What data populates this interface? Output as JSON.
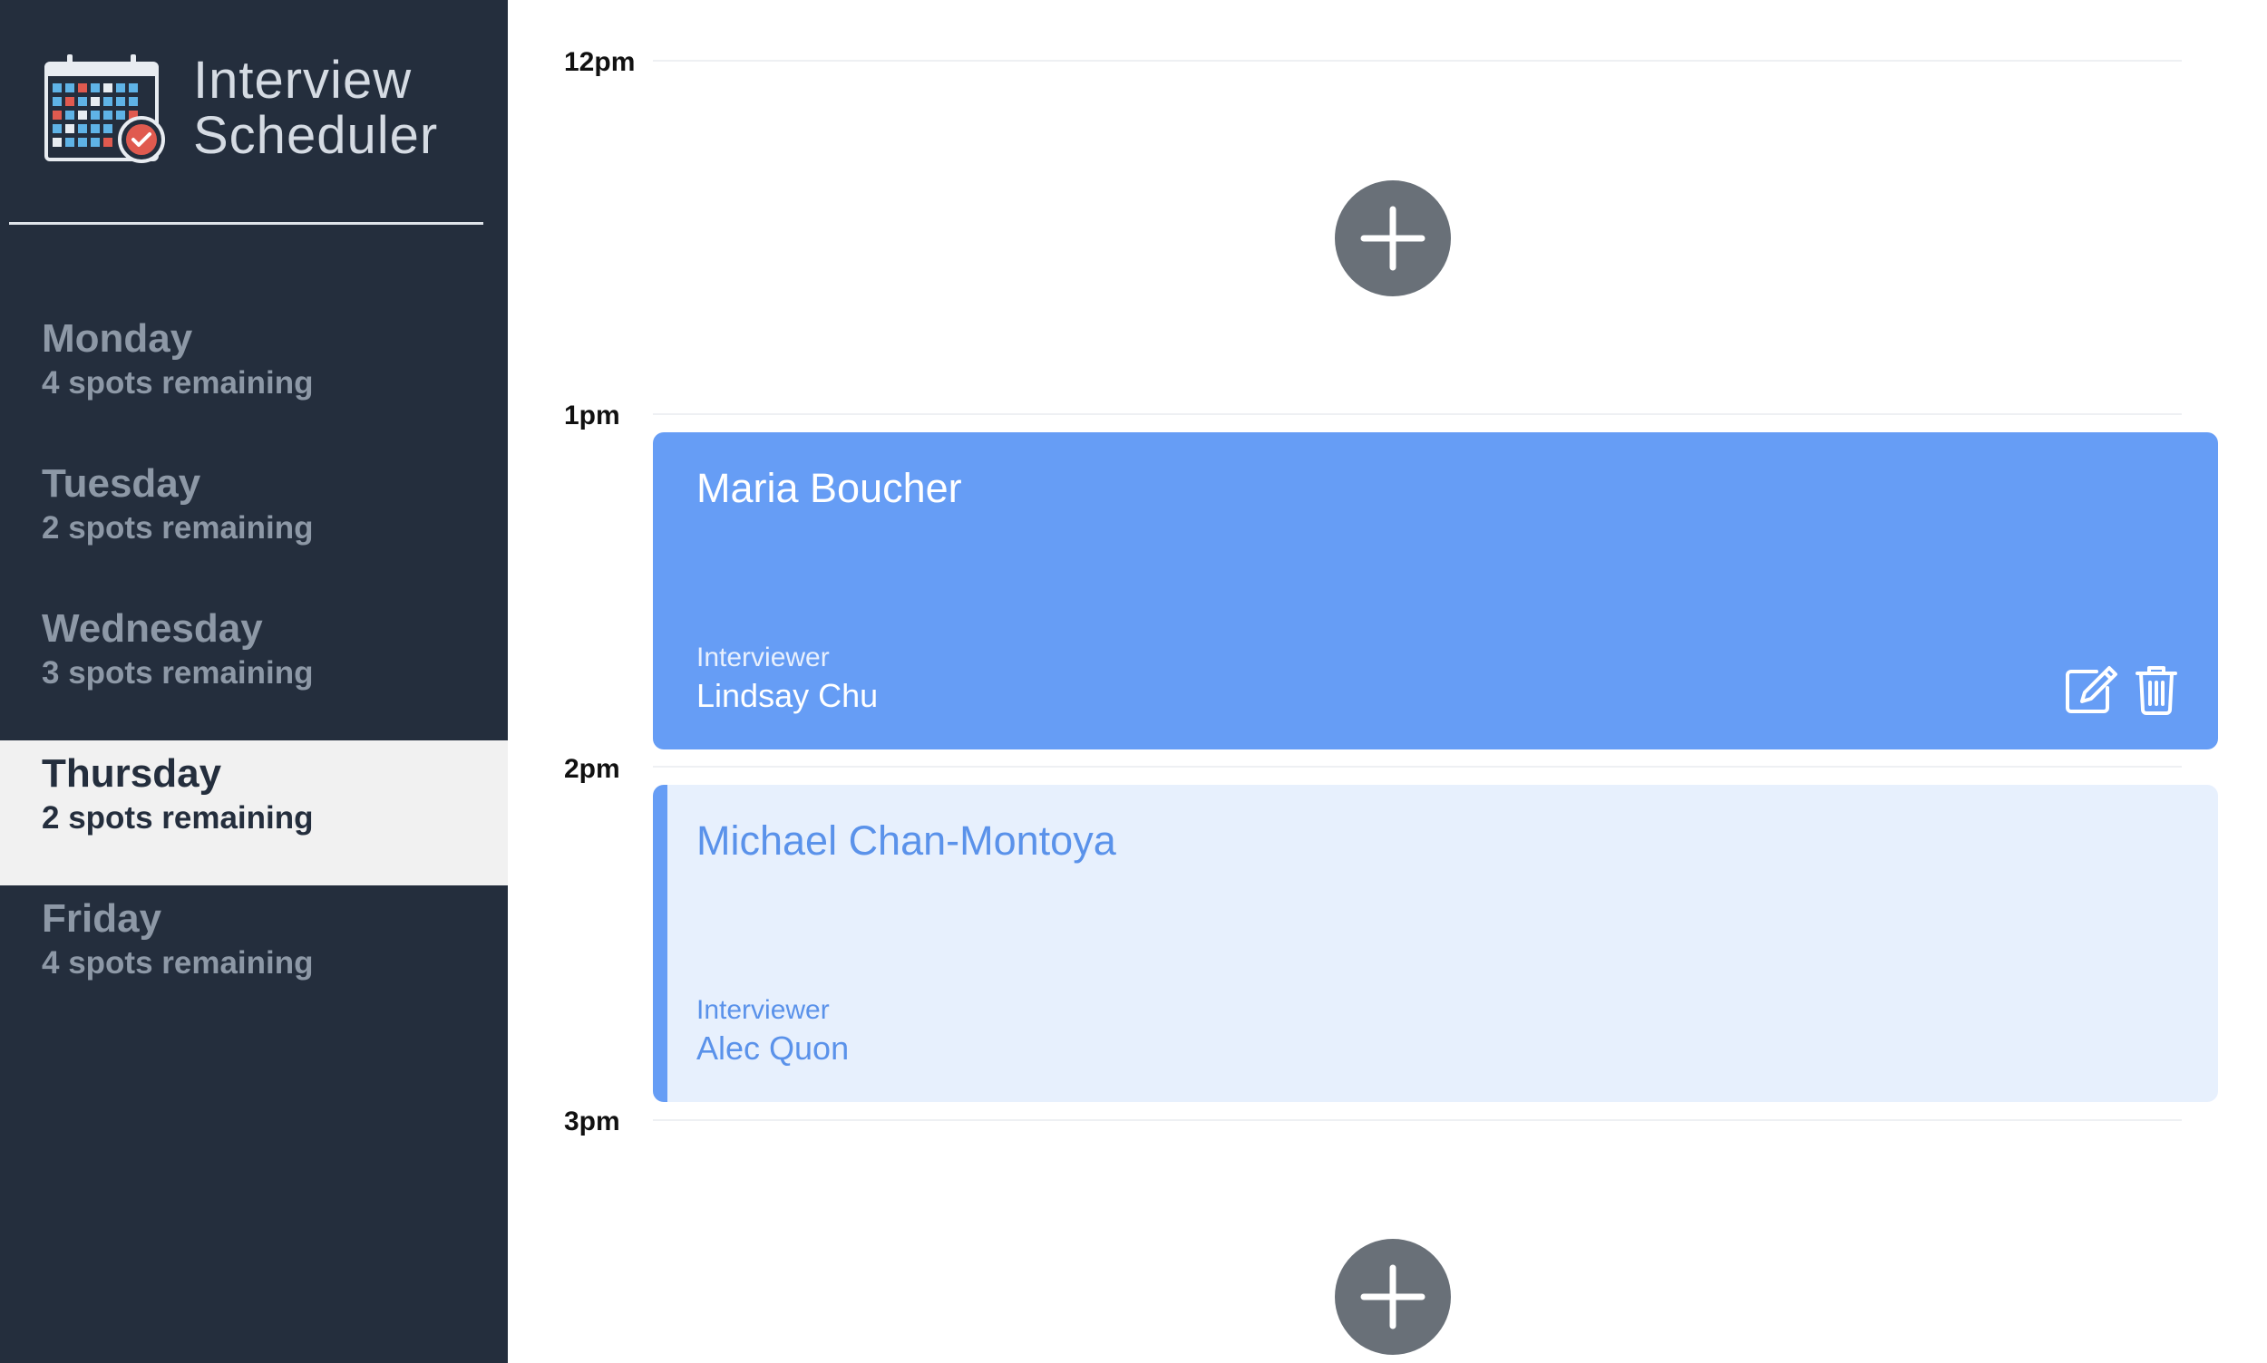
{
  "app": {
    "title_line1": "Interview",
    "title_line2": "Scheduler"
  },
  "colors": {
    "sidebar_bg": "#242e3d",
    "selected_bg": "#f1f1f1",
    "accent": "#669df5",
    "accent_light": "#e7f0fd",
    "add_button": "#697078"
  },
  "days": [
    {
      "name": "Monday",
      "spots": "4 spots remaining",
      "selected": false
    },
    {
      "name": "Tuesday",
      "spots": "2 spots remaining",
      "selected": false
    },
    {
      "name": "Wednesday",
      "spots": "3 spots remaining",
      "selected": false
    },
    {
      "name": "Thursday",
      "spots": "2 spots remaining",
      "selected": true
    },
    {
      "name": "Friday",
      "spots": "4 spots remaining",
      "selected": false
    }
  ],
  "schedule": {
    "times": [
      "12pm",
      "1pm",
      "2pm",
      "3pm"
    ],
    "appointments": [
      {
        "student": "Maria Boucher",
        "interviewer_label": "Interviewer",
        "interviewer": "Lindsay Chu",
        "state": "booked",
        "actions": [
          "edit-icon",
          "trash-icon"
        ]
      },
      {
        "student": "Michael Chan-Montoya",
        "interviewer_label": "Interviewer",
        "interviewer": "Alec Quon",
        "state": "pending"
      }
    ],
    "empty_slot_icon": "plus-icon"
  }
}
